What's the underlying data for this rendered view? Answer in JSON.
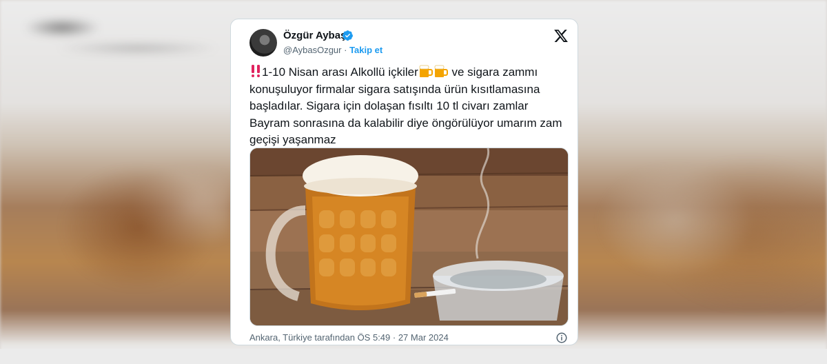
{
  "tweet": {
    "author_name": "Özgür Aybaş",
    "handle": "@AybasOzgur",
    "separator": " · ",
    "follow_label": "Takip et",
    "text_lead": "1-10 Nisan arası Alkollü içkiler",
    "text_rest": " ve sigara zammı konuşuluyor firmalar sigara satışında ürün kısıtlamasına başladılar. Sigara için dolaşan fısıltı 10 tl civarı zamlar Bayram sonrasına da kalabilir diye öngörülüyor umarım zam geçişi yaşanmaz",
    "meta": "Ankara, Türkiye tarafından ÖS 5:49 · 27 Mar 2024",
    "image_subject": "beer-mug-and-ashtray-photo",
    "icons": [
      "verified-badge-icon",
      "x-logo-icon",
      "double-exclamation-icon",
      "beer-mug-icon",
      "info-icon"
    ],
    "colors": {
      "link": "#1d9bf0",
      "text": "#0f1419",
      "muted": "#536471",
      "exclaim": "#e0245e"
    }
  }
}
